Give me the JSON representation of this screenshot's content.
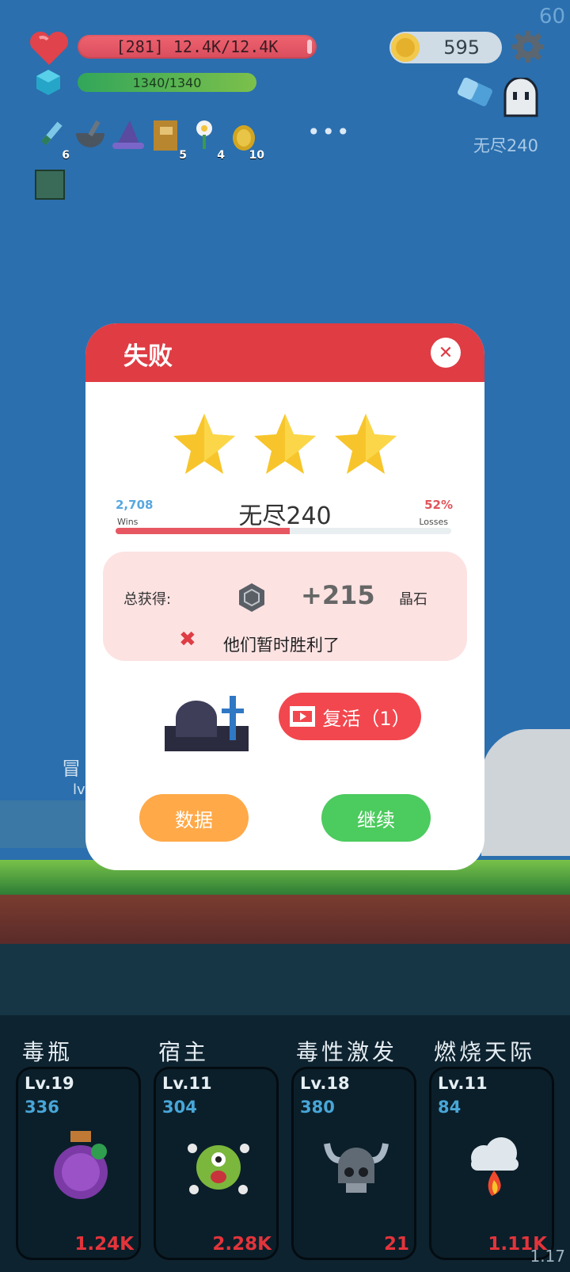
{
  "fps": "60",
  "version": "1.17",
  "hud": {
    "hp_text": "[281] 12.4K/12.4K",
    "mp_text": "1340/1340",
    "coins": "595",
    "endless_label": "无尽240"
  },
  "inventory": [
    {
      "icon": "syringe-icon",
      "count": "6"
    },
    {
      "icon": "mortar-icon",
      "count": ""
    },
    {
      "icon": "wizard-hat-icon",
      "count": ""
    },
    {
      "icon": "book-icon",
      "count": "5"
    },
    {
      "icon": "flower-icon",
      "count": "4"
    },
    {
      "icon": "pineapple-icon",
      "count": "10"
    }
  ],
  "more": "•••",
  "background": {
    "left_text_1": "冒",
    "left_text_2": "lv"
  },
  "modal": {
    "title": "失败",
    "stage_name": "无尽240",
    "wins_value": "2,708",
    "wins_label": "Wins",
    "losses_value": "52%",
    "losses_label": "Losses",
    "loss_rate": 0.52,
    "reward_label": "总获得:",
    "reward_amount": "+215",
    "reward_unit": "晶石",
    "fail_message": "他们暂时胜利了",
    "revive_label": "复活（1）",
    "stats_label": "数据",
    "continue_label": "继续",
    "stars": 3
  },
  "skills": [
    {
      "name": "毒瓶",
      "level": "Lv.19",
      "value": "336",
      "foot": "1.24K",
      "icon": "poison-bottle-icon"
    },
    {
      "name": "宿主",
      "level": "Lv.11",
      "value": "304",
      "foot": "2.28K",
      "icon": "monster-icon"
    },
    {
      "name": "毒性激发",
      "level": "Lv.18",
      "value": "380",
      "foot": "21",
      "icon": "viking-skull-icon"
    },
    {
      "name": "燃烧天际",
      "level": "Lv.11",
      "value": "84",
      "foot": "1.11K",
      "icon": "fire-cloud-icon"
    }
  ],
  "colors": {
    "accent_red": "#df3c44",
    "button_orange": "#ffa949",
    "button_green": "#4ccb5e",
    "star_yellow": "#f7c52b"
  }
}
